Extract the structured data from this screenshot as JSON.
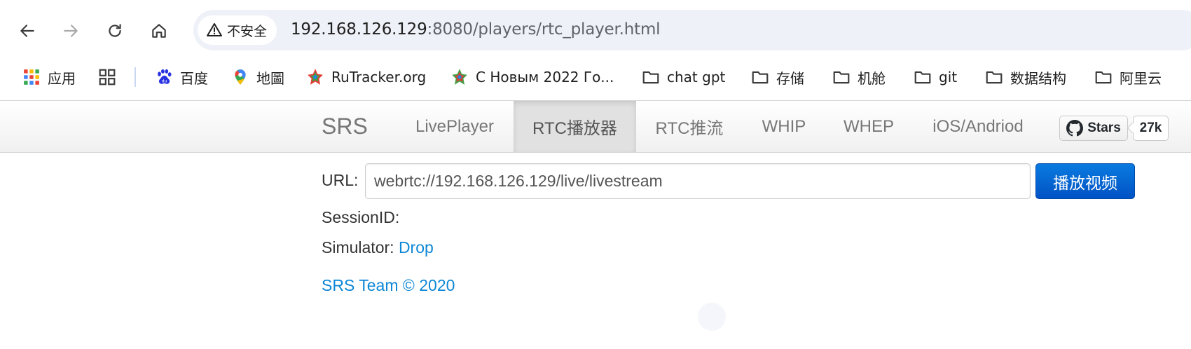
{
  "browser": {
    "security_label": "不安全",
    "url_host": "192.168.126.129",
    "url_port": ":8080",
    "url_path": "/players/rtc_player.html"
  },
  "bookmarks": [
    {
      "label": "应用",
      "icon": "apps-grid-icon"
    },
    {
      "label": "",
      "icon": "tab-groups-icon"
    },
    {
      "label": "百度",
      "icon": "baidu-paw-icon"
    },
    {
      "label": "地圖",
      "icon": "maps-pin-icon"
    },
    {
      "label": "RuTracker.org",
      "icon": "rutracker-icon"
    },
    {
      "label": "С Новым 2022 Го...",
      "icon": "star-favicon-icon"
    },
    {
      "label": "chat gpt",
      "icon": "folder-icon"
    },
    {
      "label": "存储",
      "icon": "folder-icon"
    },
    {
      "label": "机舱",
      "icon": "folder-icon"
    },
    {
      "label": "git",
      "icon": "folder-icon"
    },
    {
      "label": "数据结构",
      "icon": "folder-icon"
    },
    {
      "label": "阿里云",
      "icon": "folder-icon"
    }
  ],
  "navbar": {
    "brand": "SRS",
    "items": [
      "LivePlayer",
      "RTC播放器",
      "RTC推流",
      "WHIP",
      "WHEP",
      "iOS/Andriod"
    ],
    "active_index": 1,
    "github": {
      "label": "Stars",
      "count": "27k",
      "icon": "github-octocat-icon"
    }
  },
  "form": {
    "url_label": "URL:",
    "url_value": "webrtc://192.168.126.129/live/livestream",
    "play_button": "播放视频",
    "session_label": "SessionID:",
    "simulator_label": "Simulator:",
    "simulator_link": "Drop",
    "footer_link": "SRS Team © 2020"
  },
  "colors": {
    "link": "#0d87d6",
    "primary_button": "#0a6fd6",
    "omnibox": "#eef1f8"
  }
}
